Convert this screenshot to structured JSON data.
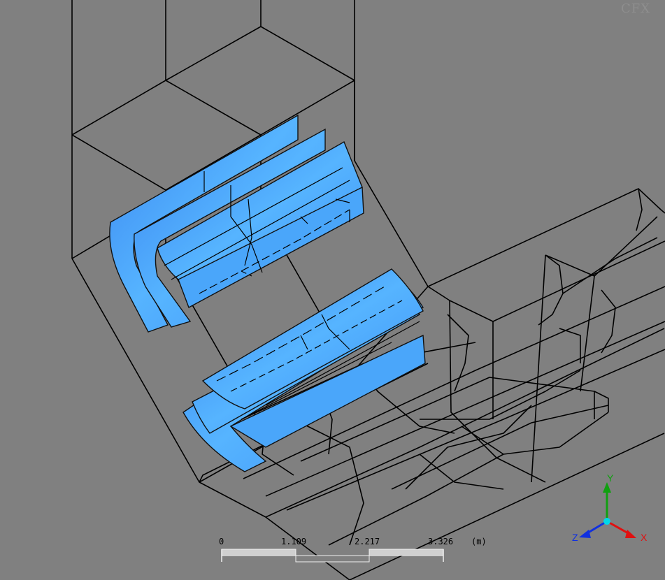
{
  "app": {
    "logo_text": "CFX"
  },
  "scale_bar": {
    "ticks": [
      "0",
      "1.109",
      "2.217",
      "3.326"
    ],
    "unit": "(m)"
  },
  "axis_triad": {
    "x_label": "X",
    "y_label": "Y",
    "z_label": "Z",
    "x_color": "#e01010",
    "y_color": "#10a010",
    "z_color": "#1030e0",
    "origin_color": "#00d8e8"
  },
  "colors": {
    "background": "#808080",
    "surface": "#4aa8ff"
  }
}
